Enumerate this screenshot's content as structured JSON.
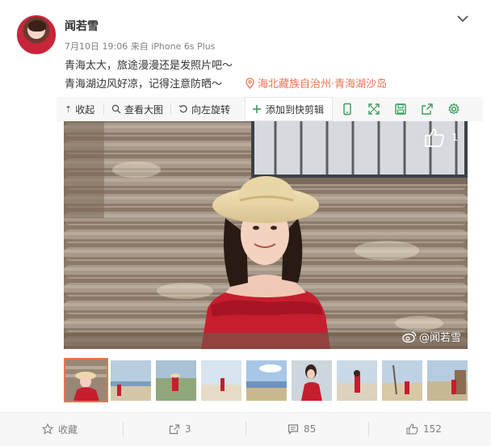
{
  "post": {
    "username": "闻若雪",
    "date": "7月10日 19:06",
    "source_prefix": "来自",
    "source": "iPhone 6s Plus",
    "text_line1": "青海太大，旅途漫漫还是发照片吧～",
    "text_line2": "青海湖边风好凉，记得注意防晒～",
    "location": "海北藏族自治州·青海湖沙岛"
  },
  "toolbar": {
    "collapse": "收起",
    "view_large": "查看大图",
    "rotate_left": "向左旋转",
    "add_clip": "添加到快剪辑"
  },
  "image": {
    "like_count": "1",
    "watermark": "@闻若雪"
  },
  "footer": {
    "favorite": "收藏",
    "repost_count": "3",
    "comment_count": "85",
    "like_count": "152"
  },
  "colors": {
    "accent": "#eb7350",
    "toolbar_icon": "#3a9a5b"
  }
}
